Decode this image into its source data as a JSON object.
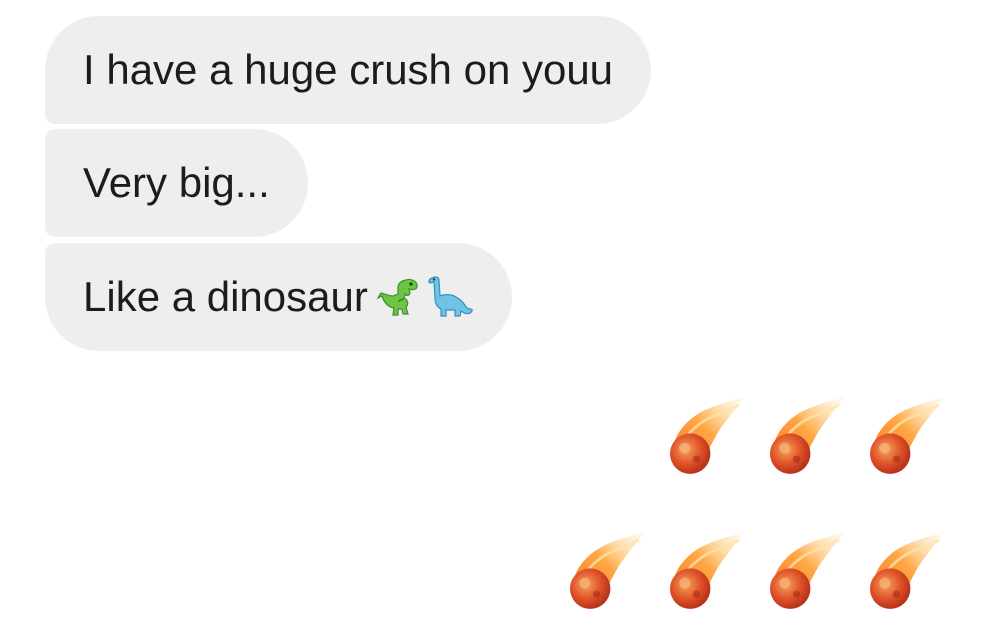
{
  "messages": [
    {
      "text": "I have a huge crush on youu"
    },
    {
      "text": "Very big..."
    },
    {
      "text": "Like a dinosaur",
      "emojis": [
        "t-rex-icon",
        "sauropod-icon"
      ]
    }
  ],
  "reaction": {
    "emoji": "comet-icon",
    "rows": [
      3,
      4
    ]
  },
  "colors": {
    "bubble": "#eeeeef",
    "text": "#1c1c1e",
    "meteor_core": "#e8552a",
    "meteor_flame": "#f7a23b"
  }
}
